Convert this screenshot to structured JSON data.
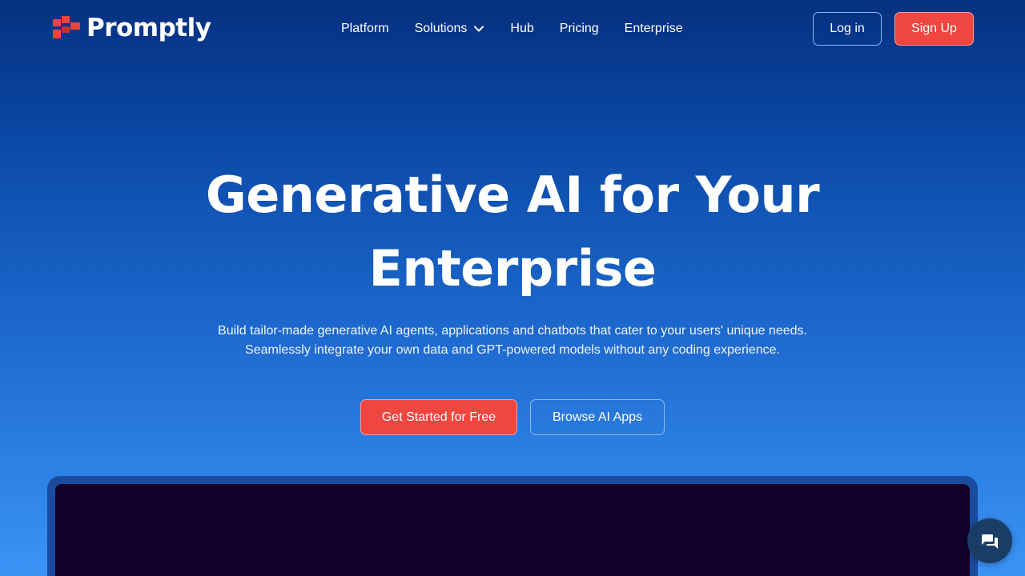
{
  "brand": {
    "name": "Promptly",
    "logo_color": "#e8463f"
  },
  "nav": {
    "items": [
      {
        "label": "Platform"
      },
      {
        "label": "Solutions",
        "has_dropdown": true
      },
      {
        "label": "Hub"
      },
      {
        "label": "Pricing"
      },
      {
        "label": "Enterprise"
      }
    ],
    "login_label": "Log in",
    "signup_label": "Sign Up"
  },
  "hero": {
    "title_line1": "Generative AI for Your",
    "title_line2": "Enterprise",
    "subtitle_line1": "Build tailor-made generative AI agents, applications and chatbots that cater to your users' unique needs.",
    "subtitle_line2": "Seamlessly integrate your own data and GPT-powered models without any coding experience.",
    "cta_primary": "Get Started for Free",
    "cta_secondary": "Browse AI Apps"
  },
  "colors": {
    "accent": "#ef4640",
    "bg_top": "#05307f",
    "bg_bottom": "#3a94f6",
    "preview_screen": "#12002a",
    "chat_button": "#1a3d68"
  },
  "icons": {
    "logo": "promptly-logo-icon",
    "dropdown": "chevron-down-icon",
    "chat": "chat-icon"
  }
}
